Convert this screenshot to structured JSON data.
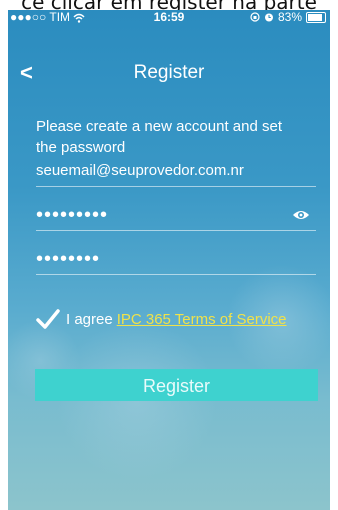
{
  "caption": "ce clicar em register na parte",
  "status_bar": {
    "carrier": "●●●○○ TIM",
    "time": "16:59",
    "battery": "83%"
  },
  "nav": {
    "back_symbol": "<",
    "title": "Register"
  },
  "prompt": "Please create a new account and set the password",
  "email_field": {
    "value": "seuemail@seuprovedor.com.nr"
  },
  "password_field": {
    "value": "•••••••••"
  },
  "confirm_field": {
    "value": "••••••••"
  },
  "agreement": {
    "text": "I agree",
    "link": "IPC 365 Terms of Service",
    "checked": true
  },
  "register_button": {
    "label": "Register"
  },
  "colors": {
    "accent": "#3ed2cf",
    "link": "#f0e24a"
  }
}
